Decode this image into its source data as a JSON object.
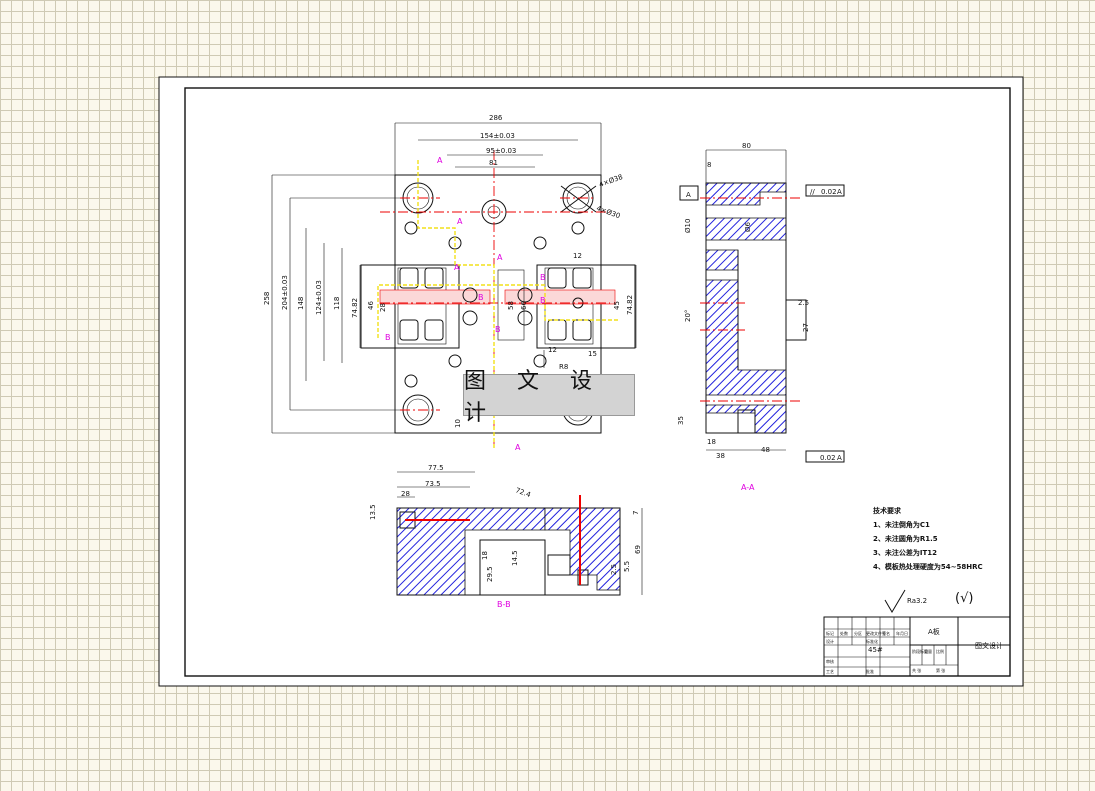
{
  "watermark": "图 文 设 计",
  "main_view": {
    "dimensions": [
      "286",
      "154±0.03",
      "95±0.03",
      "81",
      "258",
      "204±0.03",
      "148",
      "124±0.03",
      "118",
      "74.82",
      "46",
      "28",
      "58",
      "66",
      "74.82",
      "45",
      "12",
      "12",
      "15",
      "R8",
      "4×Ø38",
      "4×Ø30",
      "10"
    ],
    "section_marks": [
      "A",
      "A",
      "A",
      "A",
      "B",
      "B",
      "B",
      "B",
      "B",
      "A"
    ]
  },
  "side_view": {
    "dimensions": [
      "80",
      "8",
      "Ø10",
      "Ø6",
      "2.5",
      "27",
      "20°",
      "35",
      "18",
      "38",
      "48"
    ],
    "datum": "A",
    "tolerance_top": [
      "//",
      "0.02",
      "A"
    ],
    "tolerance_bottom": [
      "0.02",
      "A"
    ],
    "label": "A-A"
  },
  "section_b": {
    "dimensions": [
      "77.5",
      "73.5",
      "28",
      "13.5",
      "7",
      "72.4",
      "69",
      "18",
      "29.5",
      "14.5",
      "2.5",
      "5.5"
    ],
    "label": "B-B"
  },
  "tech_requirements": {
    "title": "技术要求",
    "items": [
      "1、未注倒角为C1",
      "2、未注圆角为R1.5",
      "3、未注公差为IT12",
      "4、模板热处理硬度为54~58HRC"
    ]
  },
  "roughness": {
    "symbol": "Ra3.2",
    "paren": "(√)"
  },
  "title_block": {
    "part_name": "A板",
    "material": "45#",
    "company": "图文设计",
    "cells": [
      "标记",
      "处数",
      "分区",
      "更改文件号",
      "签名",
      "年月日",
      "设计",
      "标准化",
      "审核",
      "工艺",
      "批准",
      "阶段标记",
      "重量",
      "比例",
      "共 张",
      "第 张"
    ]
  }
}
